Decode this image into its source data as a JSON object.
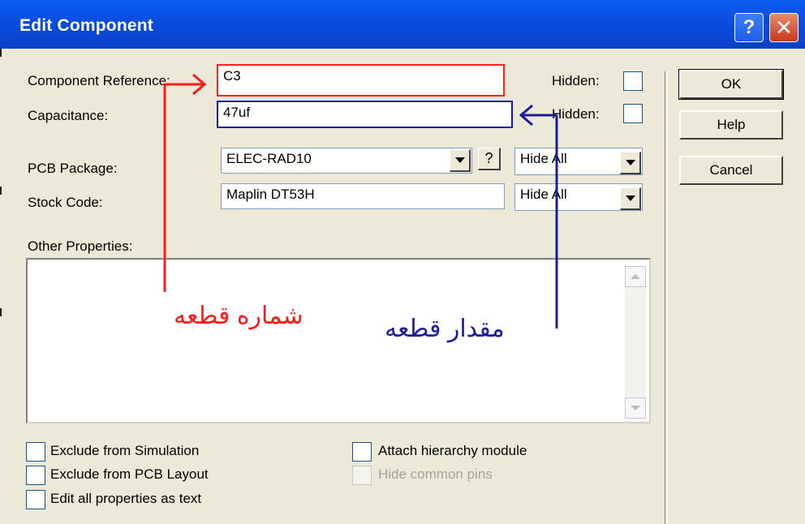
{
  "window": {
    "title": "Edit Component"
  },
  "fields": {
    "component_reference": {
      "label": "Component Reference:",
      "value": "C3",
      "hidden_label": "Hidden:"
    },
    "capacitance": {
      "label": "Capacitance:",
      "value": "47uf",
      "hidden_label": "Hidden:"
    },
    "pcb_package": {
      "label": "PCB Package:",
      "value": "ELEC-RAD10",
      "query_label": "?",
      "visibility": "Hide All"
    },
    "stock_code": {
      "label": "Stock Code:",
      "value": "Maplin DT53H",
      "visibility": "Hide All"
    },
    "other_properties": {
      "label": "Other Properties:",
      "value": ""
    }
  },
  "buttons": {
    "ok": "OK",
    "help": "Help",
    "cancel": "Cancel"
  },
  "options": {
    "exclude_simulation": "Exclude from Simulation",
    "exclude_pcb": "Exclude from PCB Layout",
    "edit_all_text": "Edit all properties as text",
    "attach_hierarchy": "Attach hierarchy module",
    "hide_common_pins": "Hide common pins"
  },
  "annotations": {
    "reference_note": "شماره قطعه",
    "value_note": "مقدار قطعه"
  },
  "colors": {
    "annotation_red": "#ff1a1a",
    "annotation_blue": "#1c1c9c",
    "titlebar": "#0a4ee0"
  }
}
